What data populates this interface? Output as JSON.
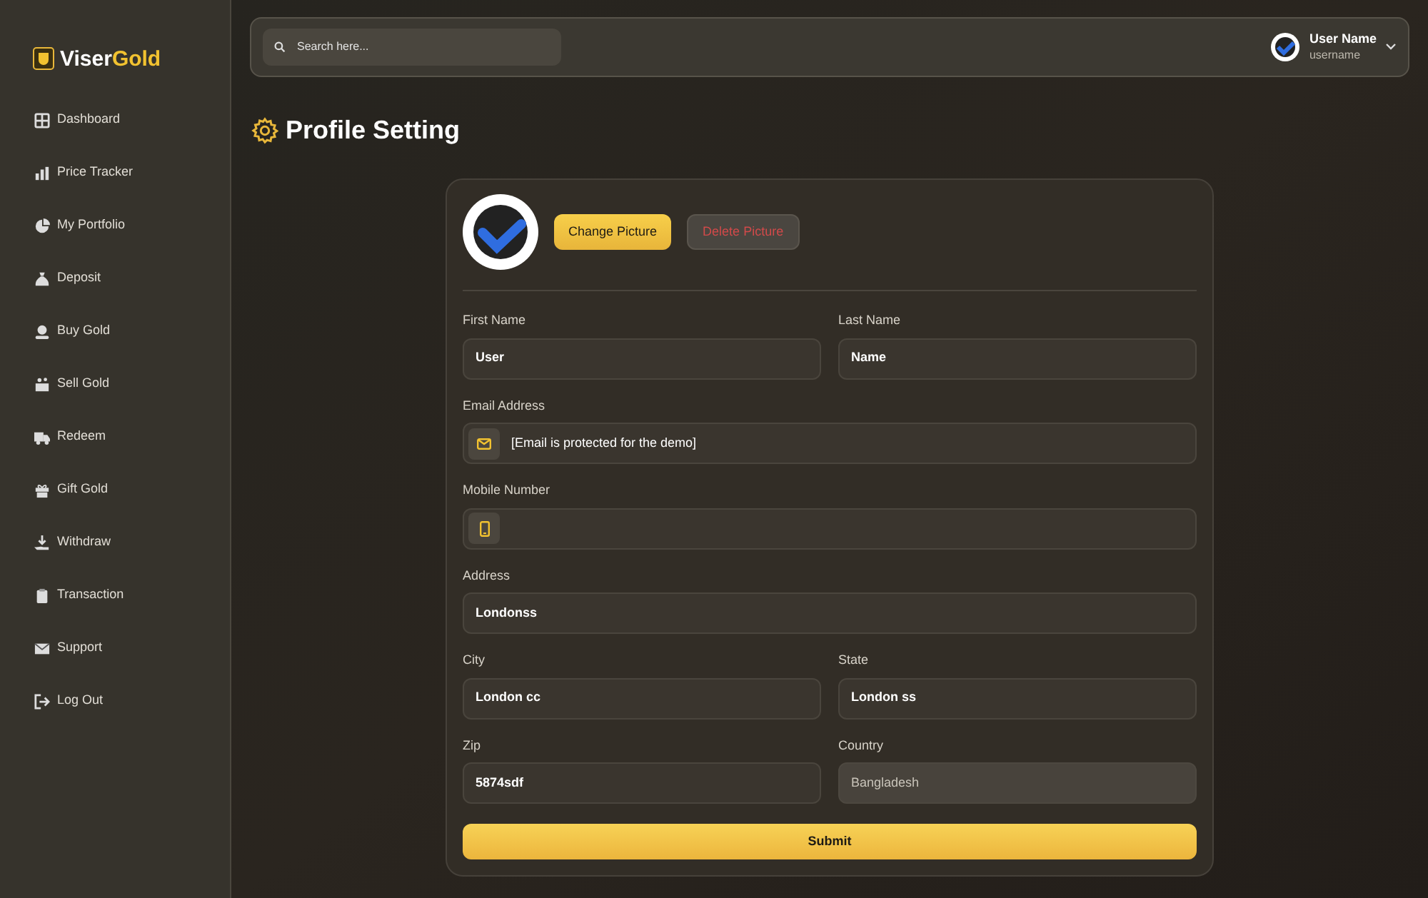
{
  "brand": {
    "first": "Viser",
    "second": "Gold"
  },
  "sidebar": {
    "items": [
      {
        "label": "Dashboard"
      },
      {
        "label": "Price Tracker"
      },
      {
        "label": "My Portfolio"
      },
      {
        "label": "Deposit"
      },
      {
        "label": "Buy Gold"
      },
      {
        "label": "Sell Gold"
      },
      {
        "label": "Redeem"
      },
      {
        "label": "Gift Gold"
      },
      {
        "label": "Withdraw"
      },
      {
        "label": "Transaction"
      },
      {
        "label": "Support"
      },
      {
        "label": "Log Out"
      }
    ]
  },
  "topbar": {
    "search": {
      "placeholder": "Search here..."
    },
    "user": {
      "name": "User Name",
      "username": "username"
    }
  },
  "page_title": "Profile Setting",
  "profile": {
    "change_button": "Change Picture",
    "delete_button": "Delete Picture"
  },
  "form": {
    "rows": [
      [
        {
          "label": "First Name",
          "value": "User",
          "kind": "text",
          "disabled": false
        },
        {
          "label": "Last Name",
          "value": "Name",
          "kind": "text",
          "disabled": false
        }
      ],
      [
        {
          "label": "Email Address",
          "value": "[Email is protected for the demo]",
          "kind": "email",
          "disabled": false
        }
      ],
      [
        {
          "label": "Mobile Number",
          "kind": "phone",
          "disabled": false
        }
      ],
      [
        {
          "label": "Address",
          "value": "Londonss",
          "kind": "text",
          "disabled": false
        }
      ],
      [
        {
          "label": "City",
          "value": "London cc",
          "kind": "text",
          "disabled": false
        },
        {
          "label": "State",
          "value": "London ss",
          "kind": "text",
          "disabled": false
        }
      ],
      [
        {
          "label": "Zip",
          "value": "5874sdf",
          "kind": "text",
          "disabled": false
        },
        {
          "label": "Country",
          "value": "Bangladesh",
          "kind": "text",
          "disabled": true
        }
      ]
    ],
    "submit": "Submit"
  }
}
